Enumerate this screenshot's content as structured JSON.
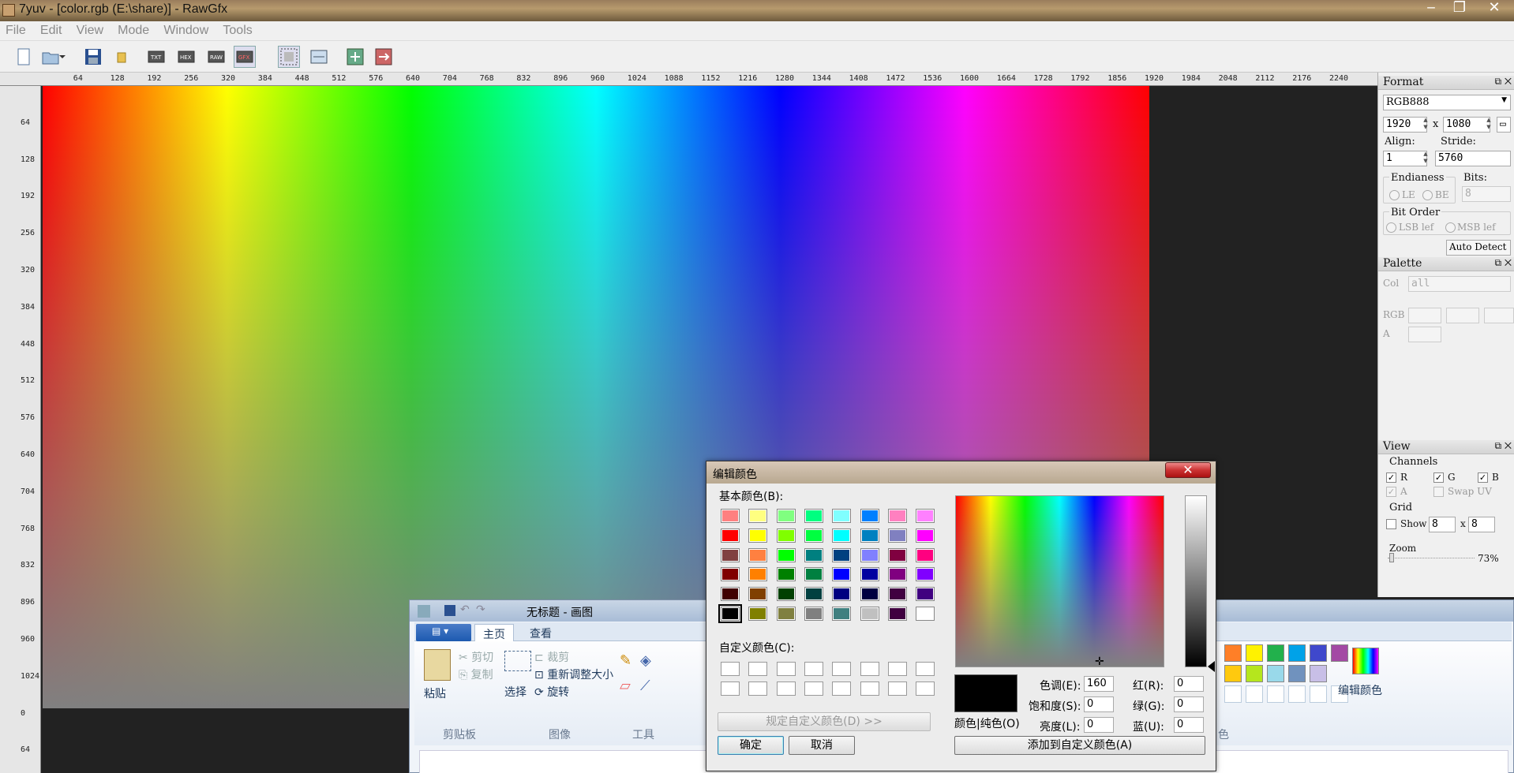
{
  "window": {
    "title": "7yuv - [color.rgb (E:\\share)] - RawGfx"
  },
  "menu": [
    "File",
    "Edit",
    "View",
    "Mode",
    "Window",
    "Tools"
  ],
  "toolbar": {
    "buttons": [
      "new-file",
      "open-file",
      "save-file",
      "folder",
      "text-mode",
      "hex-mode",
      "raw-mode",
      "gfx-mode",
      "select-rect",
      "fit-view",
      "add-image",
      "export-image"
    ]
  },
  "ruler": {
    "h": [
      "64",
      "128",
      "192",
      "256",
      "320",
      "384",
      "448",
      "512",
      "576",
      "640",
      "704",
      "768",
      "832",
      "896",
      "960",
      "1024",
      "1088",
      "1152",
      "1216",
      "1280",
      "1344",
      "1408",
      "1472",
      "1536",
      "1600",
      "1664",
      "1728",
      "1792",
      "1856",
      "1920",
      "1984",
      "2048",
      "2112",
      "2176",
      "2240"
    ],
    "v": [
      "64",
      "128",
      "192",
      "256",
      "320",
      "384",
      "448",
      "512",
      "576",
      "640",
      "704",
      "768",
      "832",
      "896",
      "960",
      "1024",
      "0",
      "64"
    ]
  },
  "panel": {
    "format": {
      "title": "Format",
      "type": "RGB888",
      "width": "1920",
      "height": "1080",
      "x": "x",
      "align_label": "Align:",
      "align": "1",
      "stride_label": "Stride:",
      "stride": "5760",
      "endianness": "Endianess",
      "le": "LE",
      "be": "BE",
      "bits_label": "Bits:",
      "bits": "8",
      "bitorder": "Bit Order",
      "lsb": "LSB lef",
      "msb": "MSB lef",
      "autodetect": "Auto Detect"
    },
    "palette": {
      "title": "Palette",
      "col_label": "Col",
      "col": "all",
      "rgb_label": "RGB",
      "a_label": "A"
    },
    "view": {
      "title": "View",
      "channels": "Channels",
      "r": "R",
      "g": "G",
      "b": "B",
      "a": "A",
      "swap": "Swap UV",
      "grid": "Grid",
      "show": "Show",
      "gx": "8",
      "x": "x",
      "gy": "8",
      "zoom_label": "Zoom",
      "zoom": "73%"
    }
  },
  "paint": {
    "title": "无标题 - 画图",
    "tabs": [
      "主页",
      "查看"
    ],
    "paste": "粘贴",
    "cut": "剪切",
    "copy": "复制",
    "select": "选择",
    "crop": "裁剪",
    "resize": "重新调整大小",
    "rotate": "旋转",
    "groups": {
      "clipboard": "剪贴板",
      "image": "图像",
      "tools": "工具",
      "colors": "色"
    },
    "edit_colors": "编辑颜色",
    "palette": [
      "#ff7f27",
      "#fff200",
      "#22b14c",
      "#00a2e8",
      "#3f48cc",
      "#a349a4",
      "#ffc90e",
      "#b5e61d",
      "#99d9ea",
      "#7092be",
      "#c8bfe7"
    ]
  },
  "dialog": {
    "title": "编辑颜色",
    "basic_label": "基本颜色(B):",
    "custom_label": "自定义颜色(C):",
    "define_btn": "规定自定义颜色(D) >>",
    "ok": "确定",
    "cancel": "取消",
    "solid_label": "颜色|纯色(O)",
    "hue_label": "色调(E):",
    "hue": "160",
    "sat_label": "饱和度(S):",
    "sat": "0",
    "lum_label": "亮度(L):",
    "lum": "0",
    "red_label": "红(R):",
    "red": "0",
    "green_label": "绿(G):",
    "green": "0",
    "blue_label": "蓝(U):",
    "blue": "0",
    "add_btn": "添加到自定义颜色(A)",
    "basic_colors": [
      [
        "#ff8080",
        "#ffff80",
        "#80ff80",
        "#00ff80",
        "#80ffff",
        "#0080ff",
        "#ff80c0",
        "#ff80ff"
      ],
      [
        "#ff0000",
        "#ffff00",
        "#80ff00",
        "#00ff40",
        "#00ffff",
        "#0080c0",
        "#8080c0",
        "#ff00ff"
      ],
      [
        "#804040",
        "#ff8040",
        "#00ff00",
        "#008080",
        "#004080",
        "#8080ff",
        "#800040",
        "#ff0080"
      ],
      [
        "#800000",
        "#ff8000",
        "#008000",
        "#008040",
        "#0000ff",
        "#0000a0",
        "#800080",
        "#8000ff"
      ],
      [
        "#400000",
        "#804000",
        "#004000",
        "#004040",
        "#000080",
        "#000040",
        "#400040",
        "#400080"
      ],
      [
        "#000000",
        "#808000",
        "#808040",
        "#808080",
        "#408080",
        "#c0c0c0",
        "#400040",
        "#ffffff"
      ]
    ]
  }
}
